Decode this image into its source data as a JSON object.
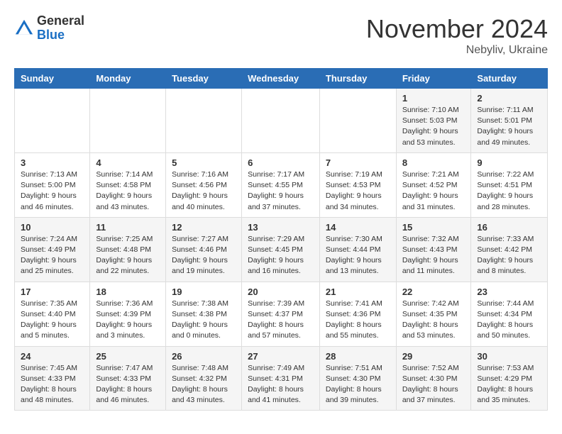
{
  "logo": {
    "general": "General",
    "blue": "Blue"
  },
  "title": "November 2024",
  "location": "Nebyliv, Ukraine",
  "weekdays": [
    "Sunday",
    "Monday",
    "Tuesday",
    "Wednesday",
    "Thursday",
    "Friday",
    "Saturday"
  ],
  "weeks": [
    [
      {
        "day": "",
        "info": ""
      },
      {
        "day": "",
        "info": ""
      },
      {
        "day": "",
        "info": ""
      },
      {
        "day": "",
        "info": ""
      },
      {
        "day": "",
        "info": ""
      },
      {
        "day": "1",
        "info": "Sunrise: 7:10 AM\nSunset: 5:03 PM\nDaylight: 9 hours and 53 minutes."
      },
      {
        "day": "2",
        "info": "Sunrise: 7:11 AM\nSunset: 5:01 PM\nDaylight: 9 hours and 49 minutes."
      }
    ],
    [
      {
        "day": "3",
        "info": "Sunrise: 7:13 AM\nSunset: 5:00 PM\nDaylight: 9 hours and 46 minutes."
      },
      {
        "day": "4",
        "info": "Sunrise: 7:14 AM\nSunset: 4:58 PM\nDaylight: 9 hours and 43 minutes."
      },
      {
        "day": "5",
        "info": "Sunrise: 7:16 AM\nSunset: 4:56 PM\nDaylight: 9 hours and 40 minutes."
      },
      {
        "day": "6",
        "info": "Sunrise: 7:17 AM\nSunset: 4:55 PM\nDaylight: 9 hours and 37 minutes."
      },
      {
        "day": "7",
        "info": "Sunrise: 7:19 AM\nSunset: 4:53 PM\nDaylight: 9 hours and 34 minutes."
      },
      {
        "day": "8",
        "info": "Sunrise: 7:21 AM\nSunset: 4:52 PM\nDaylight: 9 hours and 31 minutes."
      },
      {
        "day": "9",
        "info": "Sunrise: 7:22 AM\nSunset: 4:51 PM\nDaylight: 9 hours and 28 minutes."
      }
    ],
    [
      {
        "day": "10",
        "info": "Sunrise: 7:24 AM\nSunset: 4:49 PM\nDaylight: 9 hours and 25 minutes."
      },
      {
        "day": "11",
        "info": "Sunrise: 7:25 AM\nSunset: 4:48 PM\nDaylight: 9 hours and 22 minutes."
      },
      {
        "day": "12",
        "info": "Sunrise: 7:27 AM\nSunset: 4:46 PM\nDaylight: 9 hours and 19 minutes."
      },
      {
        "day": "13",
        "info": "Sunrise: 7:29 AM\nSunset: 4:45 PM\nDaylight: 9 hours and 16 minutes."
      },
      {
        "day": "14",
        "info": "Sunrise: 7:30 AM\nSunset: 4:44 PM\nDaylight: 9 hours and 13 minutes."
      },
      {
        "day": "15",
        "info": "Sunrise: 7:32 AM\nSunset: 4:43 PM\nDaylight: 9 hours and 11 minutes."
      },
      {
        "day": "16",
        "info": "Sunrise: 7:33 AM\nSunset: 4:42 PM\nDaylight: 9 hours and 8 minutes."
      }
    ],
    [
      {
        "day": "17",
        "info": "Sunrise: 7:35 AM\nSunset: 4:40 PM\nDaylight: 9 hours and 5 minutes."
      },
      {
        "day": "18",
        "info": "Sunrise: 7:36 AM\nSunset: 4:39 PM\nDaylight: 9 hours and 3 minutes."
      },
      {
        "day": "19",
        "info": "Sunrise: 7:38 AM\nSunset: 4:38 PM\nDaylight: 9 hours and 0 minutes."
      },
      {
        "day": "20",
        "info": "Sunrise: 7:39 AM\nSunset: 4:37 PM\nDaylight: 8 hours and 57 minutes."
      },
      {
        "day": "21",
        "info": "Sunrise: 7:41 AM\nSunset: 4:36 PM\nDaylight: 8 hours and 55 minutes."
      },
      {
        "day": "22",
        "info": "Sunrise: 7:42 AM\nSunset: 4:35 PM\nDaylight: 8 hours and 53 minutes."
      },
      {
        "day": "23",
        "info": "Sunrise: 7:44 AM\nSunset: 4:34 PM\nDaylight: 8 hours and 50 minutes."
      }
    ],
    [
      {
        "day": "24",
        "info": "Sunrise: 7:45 AM\nSunset: 4:33 PM\nDaylight: 8 hours and 48 minutes."
      },
      {
        "day": "25",
        "info": "Sunrise: 7:47 AM\nSunset: 4:33 PM\nDaylight: 8 hours and 46 minutes."
      },
      {
        "day": "26",
        "info": "Sunrise: 7:48 AM\nSunset: 4:32 PM\nDaylight: 8 hours and 43 minutes."
      },
      {
        "day": "27",
        "info": "Sunrise: 7:49 AM\nSunset: 4:31 PM\nDaylight: 8 hours and 41 minutes."
      },
      {
        "day": "28",
        "info": "Sunrise: 7:51 AM\nSunset: 4:30 PM\nDaylight: 8 hours and 39 minutes."
      },
      {
        "day": "29",
        "info": "Sunrise: 7:52 AM\nSunset: 4:30 PM\nDaylight: 8 hours and 37 minutes."
      },
      {
        "day": "30",
        "info": "Sunrise: 7:53 AM\nSunset: 4:29 PM\nDaylight: 8 hours and 35 minutes."
      }
    ]
  ]
}
